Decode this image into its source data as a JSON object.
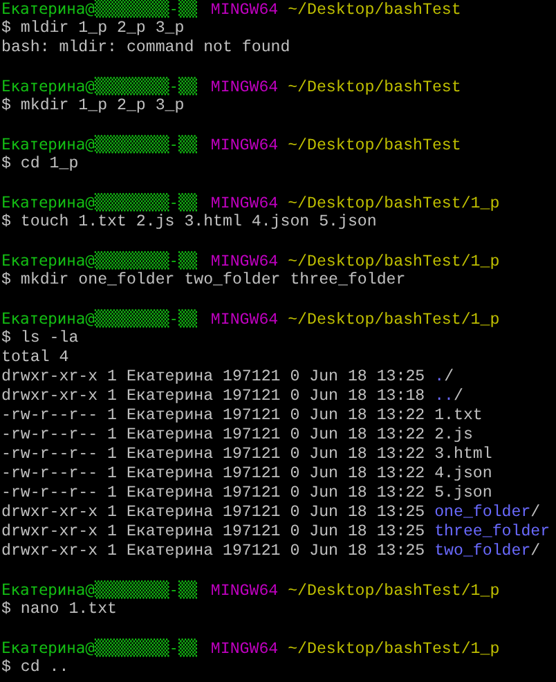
{
  "blocks": [
    {
      "prompt": {
        "user_host": "Екатерина@▒▒▒▒▒▒▒▒-▒▒",
        "system": "MINGW64",
        "path": "~/Desktop/bashTest"
      },
      "command": "$ mldir 1_p 2_p 3_p",
      "output": [
        {
          "kind": "text",
          "text": "bash: mldir: command not found"
        }
      ]
    },
    {
      "prompt": {
        "user_host": "Екатерина@▒▒▒▒▒▒▒▒-▒▒",
        "system": "MINGW64",
        "path": "~/Desktop/bashTest"
      },
      "command": "$ mkdir 1_p 2_p 3_p"
    },
    {
      "prompt": {
        "user_host": "Екатерина@▒▒▒▒▒▒▒▒-▒▒",
        "system": "MINGW64",
        "path": "~/Desktop/bashTest"
      },
      "command": "$ cd 1_p"
    },
    {
      "prompt": {
        "user_host": "Екатерина@▒▒▒▒▒▒▒▒-▒▒",
        "system": "MINGW64",
        "path": "~/Desktop/bashTest/1_p"
      },
      "command": "$ touch 1.txt 2.js 3.html 4.json 5.json"
    },
    {
      "prompt": {
        "user_host": "Екатерина@▒▒▒▒▒▒▒▒-▒▒",
        "system": "MINGW64",
        "path": "~/Desktop/bashTest/1_p"
      },
      "command": "$ mkdir one_folder two_folder three_folder"
    },
    {
      "prompt": {
        "user_host": "Екатерина@▒▒▒▒▒▒▒▒-▒▒",
        "system": "MINGW64",
        "path": "~/Desktop/bashTest/1_p"
      },
      "command": "$ ls -la",
      "output": [
        {
          "kind": "text",
          "text": "total 4"
        },
        {
          "kind": "dir",
          "info": "drwxr-xr-x 1 Екатерина 197121 0 Jun 18 13:25",
          "name": ".",
          "suffix": "/"
        },
        {
          "kind": "dir",
          "info": "drwxr-xr-x 1 Екатерина 197121 0 Jun 18 13:18",
          "name": "..",
          "suffix": "/"
        },
        {
          "kind": "file",
          "info": "-rw-r--r-- 1 Екатерина 197121 0 Jun 18 13:22",
          "name": "1.txt"
        },
        {
          "kind": "file",
          "info": "-rw-r--r-- 1 Екатерина 197121 0 Jun 18 13:22",
          "name": "2.js"
        },
        {
          "kind": "file",
          "info": "-rw-r--r-- 1 Екатерина 197121 0 Jun 18 13:22",
          "name": "3.html"
        },
        {
          "kind": "file",
          "info": "-rw-r--r-- 1 Екатерина 197121 0 Jun 18 13:22",
          "name": "4.json"
        },
        {
          "kind": "file",
          "info": "-rw-r--r-- 1 Екатерина 197121 0 Jun 18 13:22",
          "name": "5.json"
        },
        {
          "kind": "dir",
          "info": "drwxr-xr-x 1 Екатерина 197121 0 Jun 18 13:25",
          "name": "one_folder",
          "suffix": "/"
        },
        {
          "kind": "dir",
          "info": "drwxr-xr-x 1 Екатерина 197121 0 Jun 18 13:25",
          "name": "three_folder"
        },
        {
          "kind": "dir",
          "info": "drwxr-xr-x 1 Екатерина 197121 0 Jun 18 13:25",
          "name": "two_folder",
          "suffix": "/"
        }
      ]
    },
    {
      "prompt": {
        "user_host": "Екатерина@▒▒▒▒▒▒▒▒-▒▒",
        "system": "MINGW64",
        "path": "~/Desktop/bashTest/1_p"
      },
      "command": "$ nano 1.txt"
    },
    {
      "prompt": {
        "user_host": "Екатерина@▒▒▒▒▒▒▒▒-▒▒",
        "system": "MINGW64",
        "path": "~/Desktop/bashTest/1_p"
      },
      "command": "$ cd .."
    }
  ]
}
